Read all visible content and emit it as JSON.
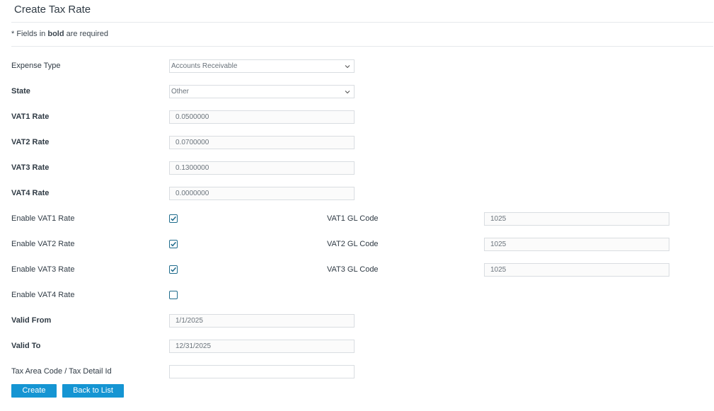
{
  "page": {
    "title": "Create Tax Rate",
    "note_prefix": "* Fields in ",
    "note_bold": "bold",
    "note_suffix": " are required"
  },
  "form": {
    "expense_type": {
      "label": "Expense Type",
      "value": "Accounts Receivable"
    },
    "state": {
      "label": "State",
      "value": "Other"
    },
    "vat1_rate": {
      "label": "VAT1 Rate",
      "value": "0.0500000"
    },
    "vat2_rate": {
      "label": "VAT2 Rate",
      "value": "0.0700000"
    },
    "vat3_rate": {
      "label": "VAT3 Rate",
      "value": "0.1300000"
    },
    "vat4_rate": {
      "label": "VAT4 Rate",
      "value": "0.0000000"
    },
    "enable_vat1": {
      "label": "Enable VAT1 Rate",
      "checked": true
    },
    "enable_vat2": {
      "label": "Enable VAT2 Rate",
      "checked": true
    },
    "enable_vat3": {
      "label": "Enable VAT3 Rate",
      "checked": true
    },
    "enable_vat4": {
      "label": "Enable VAT4 Rate",
      "checked": false
    },
    "vat1_gl": {
      "label": "VAT1 GL Code",
      "value": "1025"
    },
    "vat2_gl": {
      "label": "VAT2 GL Code",
      "value": "1025"
    },
    "vat3_gl": {
      "label": "VAT3 GL Code",
      "value": "1025"
    },
    "valid_from": {
      "label": "Valid From",
      "value": "1/1/2025"
    },
    "valid_to": {
      "label": "Valid To",
      "value": "12/31/2025"
    },
    "tax_area": {
      "label": "Tax Area Code / Tax Detail Id",
      "value": ""
    }
  },
  "buttons": {
    "create": "Create",
    "back": "Back to List"
  },
  "colors": {
    "accent": "#1595d3",
    "checkbox": "#1e6b8c"
  }
}
